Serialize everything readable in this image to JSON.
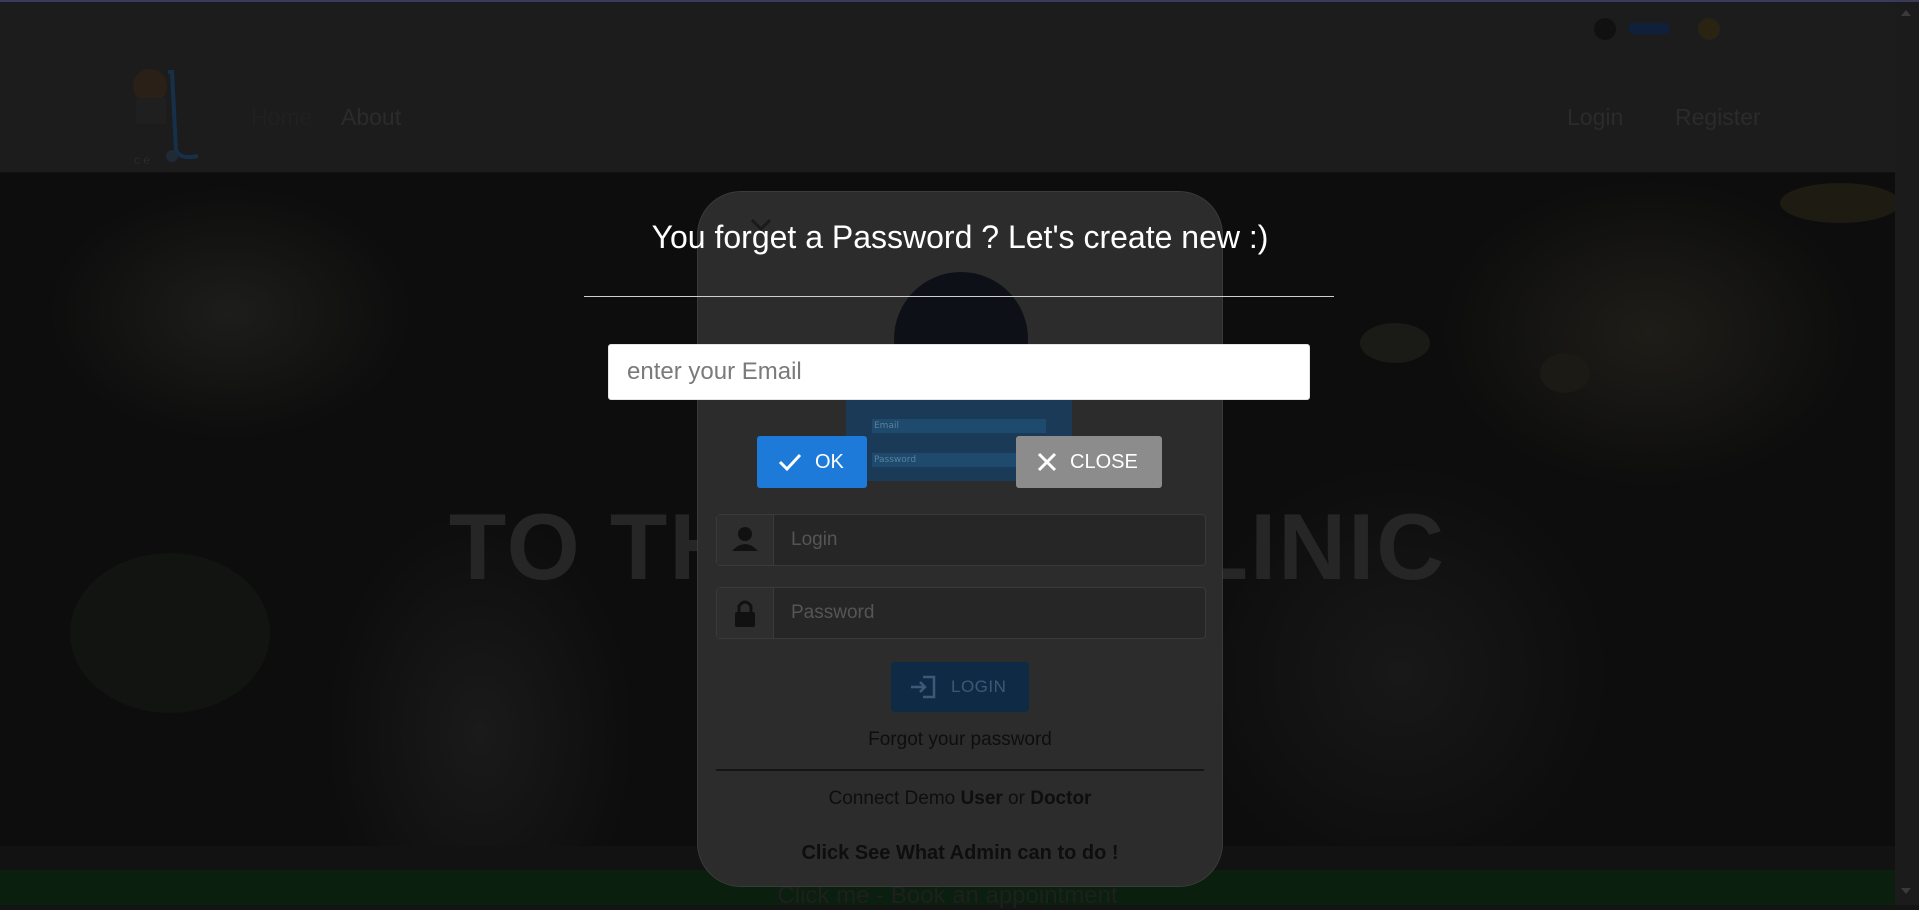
{
  "navbar": {
    "links": {
      "home": "Home",
      "about": "About",
      "login": "Login",
      "register": "Register"
    }
  },
  "hero": {
    "title": "TO THE DI              RE CLINIC"
  },
  "footer": {
    "appointment_text": "Click me - Book an appointment"
  },
  "login_card": {
    "login_placeholder": "Login",
    "password_placeholder": "Password",
    "login_button": "LOGIN",
    "forgot_link": "Forgot your password",
    "demo_prefix": "Connect Demo ",
    "demo_user": "User",
    "demo_or": " or ",
    "demo_doctor": "Doctor",
    "admin_link": "Click See What Admin can to do !",
    "preview_email": "Email",
    "preview_password": "Password"
  },
  "modal": {
    "title": "You forget a Password ? Let's create new :)",
    "email_placeholder": "enter your Email",
    "email_value": "",
    "ok_label": "OK",
    "close_label": "CLOSE"
  },
  "colors": {
    "ok_button": "#1e7ad8",
    "close_button": "#8c8c8c",
    "overlay": "#141414"
  },
  "icons": {
    "ok": "check-icon",
    "close": "x-icon",
    "login_field": "user-icon",
    "password_field": "lock-icon",
    "login_button": "sign-in-icon"
  }
}
